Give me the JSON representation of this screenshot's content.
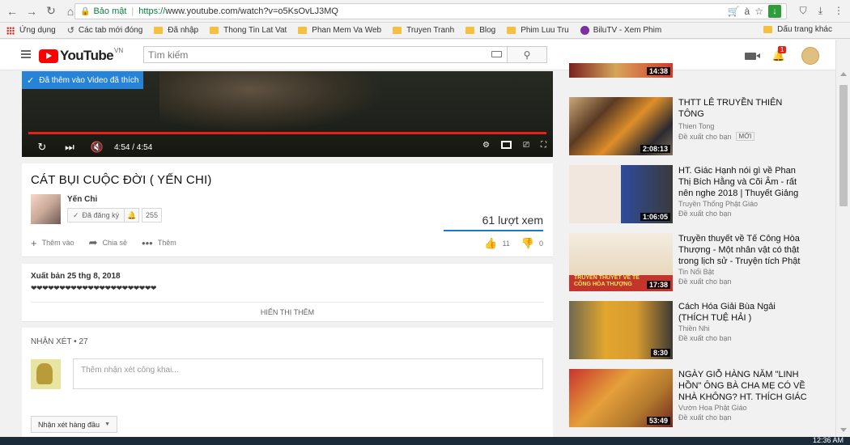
{
  "browser": {
    "security_label": "Bảo mật",
    "url_scheme": "https://",
    "url_rest": "www.youtube.com/watch?v=o5KsOvLJ3MQ"
  },
  "bookmarks": {
    "apps": "Ứng dụng",
    "items": [
      "Các tab mới đóng",
      "Đã nhập",
      "Thong Tin Lat Vat",
      "Phan Mem Va Web",
      "Truyen Tranh",
      "Blog",
      "Phim Luu Tru",
      "BiluTV - Xem Phim"
    ],
    "right": "Dấu trang khác"
  },
  "header": {
    "logo": "YouTube",
    "logo_region": "VN",
    "search_placeholder": "Tìm kiếm",
    "notification_count": "1"
  },
  "player": {
    "liked_toast": "Đã thêm vào Video đã thích",
    "time": "4:54 / 4:54",
    "progress_fraction": 1.0
  },
  "video": {
    "title": "CÁT BỤI CUỘC ĐỜI ( YẾN CHI)",
    "channel": "Yến Chi",
    "subscribe_label": "Đã đăng ký",
    "subscriber_count": "255",
    "views": "61 lượt xem",
    "add_label": "Thêm vào",
    "share_label": "Chia sẻ",
    "more_label": "Thêm",
    "likes": "11",
    "dislikes": "0"
  },
  "description": {
    "published": "Xuất bản 25 thg 8, 2018",
    "text": "❤❤❤❤❤❤❤❤❤❤❤❤❤❤❤❤❤❤❤❤❤❤",
    "show_more": "HIỂN THỊ THÊM"
  },
  "comments": {
    "title": "NHẬN XÉT • 27",
    "placeholder": "Thêm nhận xét công khai...",
    "sort_label": "Nhận xét hàng đầu"
  },
  "recommendations": [
    {
      "title": "",
      "channel": "",
      "meta": "",
      "duration": "14:38"
    },
    {
      "title": "THTT LÊ TRUYỀN THIÊN TÔNG",
      "channel": "Thien Tong",
      "meta": "Đề xuất cho bạn",
      "badge": "MỚI",
      "duration": "2:08:13"
    },
    {
      "title": "HT. Giác Hạnh nói gì về Phan Thị Bích Hằng và Cõi Âm - rất nên nghe 2018 | Thuyết Giảng",
      "channel": "Truyền Thống Phật Giáo",
      "meta": "Đề xuất cho bạn",
      "duration": "1:06:05"
    },
    {
      "title": "Truyền thuyết về Tế Công Hòa Thượng - Một nhân vật có thật trong lịch sử - Truyện tích Phật",
      "channel": "Tin Nổi Bật",
      "meta": "Đề xuất cho bạn",
      "duration": "17:38",
      "thumb_text": "TRUYỀN THUYẾT VỀ TẾ CÔNG HÒA THƯỢNG"
    },
    {
      "title": "Cách Hóa Giải Bùa Ngải (THÍCH TUỆ HẢI )",
      "channel": "Thiền Nhi",
      "meta": "Đề xuất cho bạn",
      "duration": "8:30"
    },
    {
      "title": "NGÀY GIỖ HÀNG NĂM \"LINH HỒN\" ÔNG BÀ CHA MẸ CÓ VỀ NHÀ KHÔNG? HT. THÍCH GIÁC",
      "channel": "Vườn Hoa Phật Giáo",
      "meta": "Đề xuất cho bạn",
      "duration": "53:49"
    }
  ],
  "taskbar": {
    "clock": "12:36 AM"
  }
}
